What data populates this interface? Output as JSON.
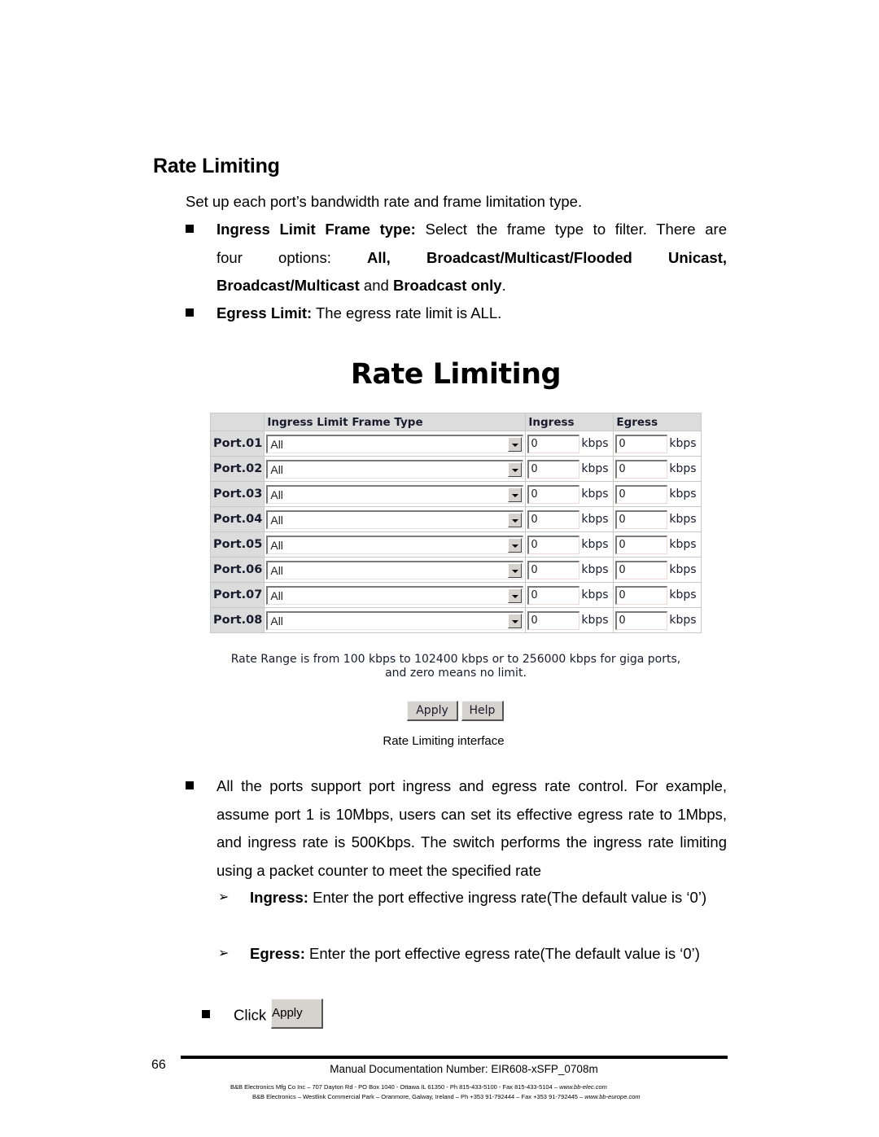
{
  "section": {
    "title": "Rate Limiting",
    "intro": "Set up each port’s bandwidth rate and frame limitation type."
  },
  "bullets": {
    "ingress_limit": {
      "label": "Ingress Limit Frame type:",
      "text1": " Select the frame type to filter. There are",
      "text2_plain": "four options:",
      "opt_all": "All,",
      "opt_bmfu": "Broadcast/Multicast/Flooded Unicast,",
      "opt_bm": "Broadcast/Multicast",
      "and": " and ",
      "opt_b": "Broadcast only",
      "period": "."
    },
    "egress_limit": {
      "label": "Egress Limit:",
      "text": " The egress rate limit is ALL."
    },
    "all_ports": {
      "text": "All the ports support port ingress and egress rate control. For example, assume port 1 is 10Mbps, users can set its effective egress rate to 1Mbps, and ingress rate is 500Kbps. The switch performs the ingress rate limiting using a packet counter to meet the specified rate"
    },
    "sub_ingress": {
      "label": "Ingress:",
      "text": " Enter the port effective ingress rate(The default value is ‘0’)"
    },
    "sub_egress": {
      "label": "Egress:",
      "text": " Enter the port effective egress rate(The default value is ‘0’)"
    },
    "click": {
      "text": "Click",
      "button": "Apply"
    }
  },
  "screenshot": {
    "title": "Rate Limiting",
    "headers": {
      "port": "",
      "frame_type": "Ingress Limit Frame Type",
      "ingress": "Ingress",
      "egress": "Egress"
    },
    "unit": "kbps",
    "rows": [
      {
        "port": "Port.01",
        "frame_type": "All",
        "ingress": "0",
        "egress": "0"
      },
      {
        "port": "Port.02",
        "frame_type": "All",
        "ingress": "0",
        "egress": "0"
      },
      {
        "port": "Port.03",
        "frame_type": "All",
        "ingress": "0",
        "egress": "0"
      },
      {
        "port": "Port.04",
        "frame_type": "All",
        "ingress": "0",
        "egress": "0"
      },
      {
        "port": "Port.05",
        "frame_type": "All",
        "ingress": "0",
        "egress": "0"
      },
      {
        "port": "Port.06",
        "frame_type": "All",
        "ingress": "0",
        "egress": "0"
      },
      {
        "port": "Port.07",
        "frame_type": "All",
        "ingress": "0",
        "egress": "0"
      },
      {
        "port": "Port.08",
        "frame_type": "All",
        "ingress": "0",
        "egress": "0"
      }
    ],
    "note_line1": "Rate Range is from 100 kbps to 102400 kbps or to 256000 kbps for giga ports,",
    "note_line2": "and zero means no limit.",
    "apply_label": "Apply",
    "help_label": "Help"
  },
  "caption": "Rate Limiting interface",
  "footer": {
    "page_number": "66",
    "doc_number": "Manual Documentation Number: EIR608-xSFP_0708m",
    "line1_text": "B&B Electronics Mfg Co Inc – 707 Dayton Rd - PO Box 1040 - Ottawa IL 61350 - Ph 815-433-5100 - Fax 815-433-5104 – ",
    "line1_url": "www.bb-elec.com",
    "line2_text": "B&B Electronics – Westlink Commercial Park – Oranmore, Galway, Ireland – Ph +353 91-792444 – Fax +353 91-792445 – ",
    "line2_url": "www.bb-europe.com"
  }
}
